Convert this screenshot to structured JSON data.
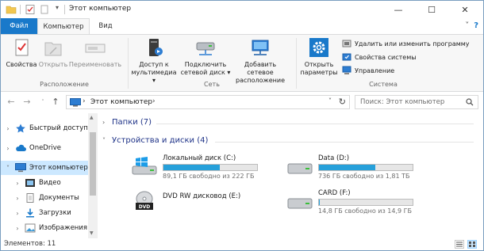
{
  "window": {
    "title": "Этот компьютер",
    "minimize": "—",
    "maximize": "☐",
    "close": "✕"
  },
  "tabs": {
    "file": "Файл",
    "computer": "Компьютер",
    "view": "Вид"
  },
  "ribbon": {
    "location": {
      "properties": "Свойства",
      "open": "Открыть",
      "rename": "Переименовать",
      "label": "Расположение"
    },
    "network": {
      "media_line1": "Доступ к",
      "media_line2": "мультимедиа ▾",
      "map_line1": "Подключить",
      "map_line2": "сетевой диск ▾",
      "add_line1": "Добавить сетевое",
      "add_line2": "расположение",
      "label": "Сеть"
    },
    "system": {
      "settings_line1": "Открыть",
      "settings_line2": "параметры",
      "uninstall": "Удалить или изменить программу",
      "sysprops": "Свойства системы",
      "manage": "Управление",
      "label": "Система"
    }
  },
  "address": {
    "path": "Этот компьютер",
    "separator": "›",
    "search_placeholder": "Поиск: Этот компьютер"
  },
  "nav": {
    "items": [
      {
        "label": "Быстрый доступ",
        "expanded": false,
        "icon": "star-icon"
      },
      {
        "label": "OneDrive",
        "expanded": false,
        "icon": "cloud-icon"
      },
      {
        "label": "Этот компьютер",
        "expanded": true,
        "icon": "computer-icon"
      },
      {
        "label": "Видео",
        "expanded": false,
        "icon": "video-folder-icon"
      },
      {
        "label": "Документы",
        "expanded": false,
        "icon": "documents-folder-icon"
      },
      {
        "label": "Загрузки",
        "expanded": false,
        "icon": "downloads-folder-icon"
      },
      {
        "label": "Изображения",
        "expanded": false,
        "icon": "pictures-folder-icon"
      }
    ]
  },
  "content": {
    "folders_header": "Папки (7)",
    "devices_header": "Устройства и диски (4)",
    "drives": [
      {
        "name": "Локальный диск (C:)",
        "free": "89,1 ГБ свободно из 222 ГБ",
        "used_fraction": 0.6,
        "icon": "windows-drive-icon"
      },
      {
        "name": "Data (D:)",
        "free": "736 ГБ свободно из 1,81 ТБ",
        "used_fraction": 0.6,
        "icon": "hard-drive-icon"
      },
      {
        "name": "DVD RW дисковод (E:)",
        "free": "",
        "icon": "dvd-drive-icon"
      },
      {
        "name": "CARD (F:)",
        "free": "14,8 ГБ свободно из 14,9 ГБ",
        "used_fraction": 0.01,
        "icon": "hard-drive-icon"
      }
    ]
  },
  "status": {
    "items": "Элементов: 11"
  },
  "colors": {
    "accent": "#1979ca",
    "selection": "#cce8ff",
    "bar_fill": "#26a0da",
    "section_text": "#1e3287"
  }
}
